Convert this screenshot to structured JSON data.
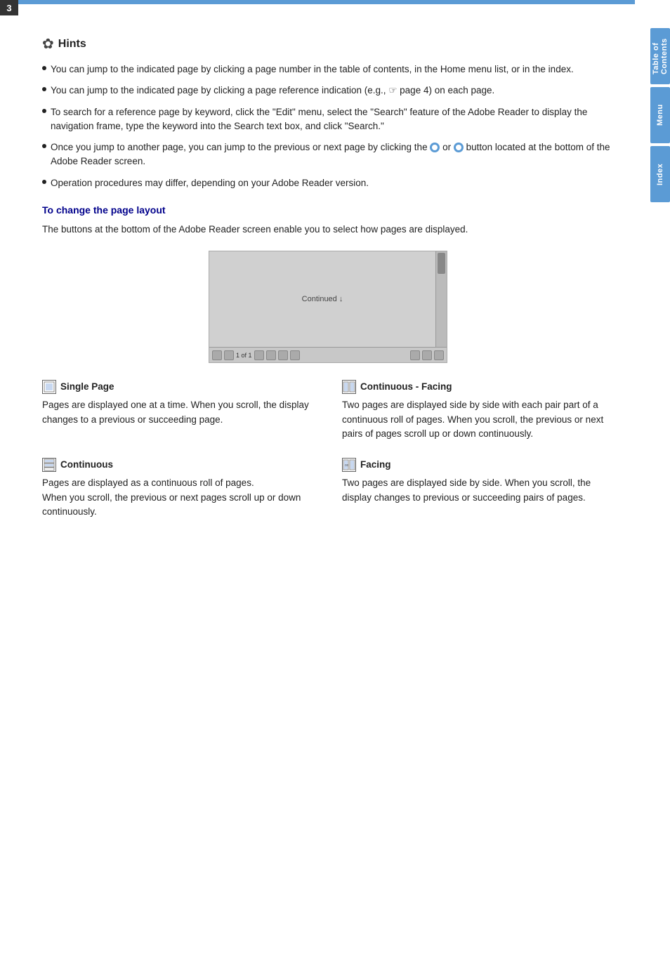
{
  "page": {
    "number": "3",
    "top_bar_color": "#5b9bd5"
  },
  "sidebar": {
    "tabs": [
      {
        "id": "table-of-contents",
        "label": "Table of\nContents"
      },
      {
        "id": "menu",
        "label": "Menu"
      },
      {
        "id": "index",
        "label": "Index"
      }
    ]
  },
  "hints": {
    "icon": "✿",
    "title": "Hints",
    "items": [
      "You can jump to the indicated page by clicking a page number in the table of contents, in the Home menu list, or in the index.",
      "You can jump to the indicated page by clicking a page reference indication (e.g., ☞ page 4) on each page.",
      "To search for a reference page by keyword, click the \"Edit\" menu, select the \"Search\" feature of the Adobe Reader to display the navigation frame, type the keyword into the Search text box, and click \"Search.\"",
      "Once you jump to another page, you can jump to the previous or next page by clicking the ● or ● button located at the bottom of the Adobe Reader screen.",
      "Operation procedures may differ, depending on your Adobe Reader version."
    ]
  },
  "page_layout": {
    "section_title": "To change the page layout",
    "description": "The buttons at the bottom of the Adobe Reader screen enable you to select how pages are displayed.",
    "mockup": {
      "continued_text": "Continued ↓"
    },
    "view_modes": [
      {
        "id": "single-page",
        "title": "Single Page",
        "description": "Pages are displayed one at a time. When you scroll, the display changes to a previous or succeeding page."
      },
      {
        "id": "continuous-facing",
        "title": "Continuous - Facing",
        "description": "Two pages are displayed side by side with each pair part of a continuous roll of pages. When you scroll, the previous or next pairs of pages scroll up or down continuously."
      },
      {
        "id": "continuous",
        "title": "Continuous",
        "description": "Pages are displayed as a continuous roll of pages.\nWhen you scroll, the previous or next pages scroll up or down continuously."
      },
      {
        "id": "facing",
        "title": "Facing",
        "description": "Two pages are displayed side by side. When you scroll, the display changes to previous or succeeding pairs of pages."
      }
    ]
  }
}
